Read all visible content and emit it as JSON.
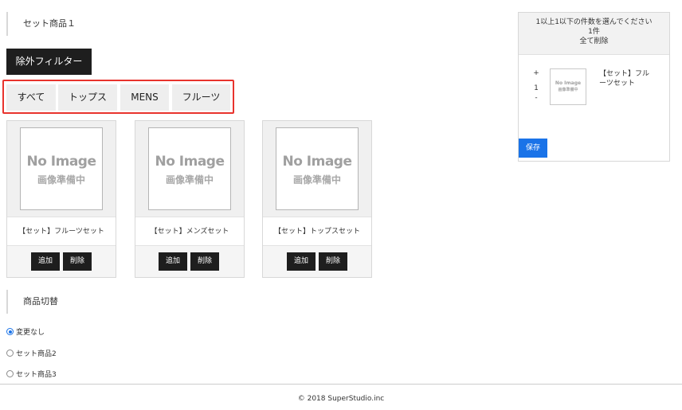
{
  "section_set": {
    "title": "セット商品１"
  },
  "exclude_filter_label": "除外フィルター",
  "filter_tabs": [
    {
      "label": "すべて"
    },
    {
      "label": "トップス"
    },
    {
      "label": "MENS"
    },
    {
      "label": "フルーツ"
    }
  ],
  "no_image": {
    "en": "No Image",
    "jp": "画像準備中"
  },
  "products": [
    {
      "name": "【セット】フルーツセット",
      "add_label": "追加",
      "delete_label": "削除"
    },
    {
      "name": "【セット】メンズセット",
      "add_label": "追加",
      "delete_label": "削除"
    },
    {
      "name": "【セット】トップスセット",
      "add_label": "追加",
      "delete_label": "削除"
    }
  ],
  "section_switch": {
    "title": "商品切替"
  },
  "radio_options": [
    {
      "label": "変更なし",
      "checked": true
    },
    {
      "label": "セット商品2",
      "checked": false
    },
    {
      "label": "セット商品3",
      "checked": false
    }
  ],
  "cart": {
    "instruction": "1以上1以下の件数を選んでください",
    "count": "1件",
    "clear_all": "全て削除",
    "item": {
      "plus": "+",
      "quantity": "1",
      "minus": "-",
      "name": "【セット】フルーツセット"
    },
    "save_label": "保存"
  },
  "footer": {
    "copyright": "© 2018 SuperStudio.inc"
  },
  "colors": {
    "dark_button": "#1e1e1e",
    "accent_blue": "#1a73e8",
    "highlight_red": "#e8332d"
  }
}
